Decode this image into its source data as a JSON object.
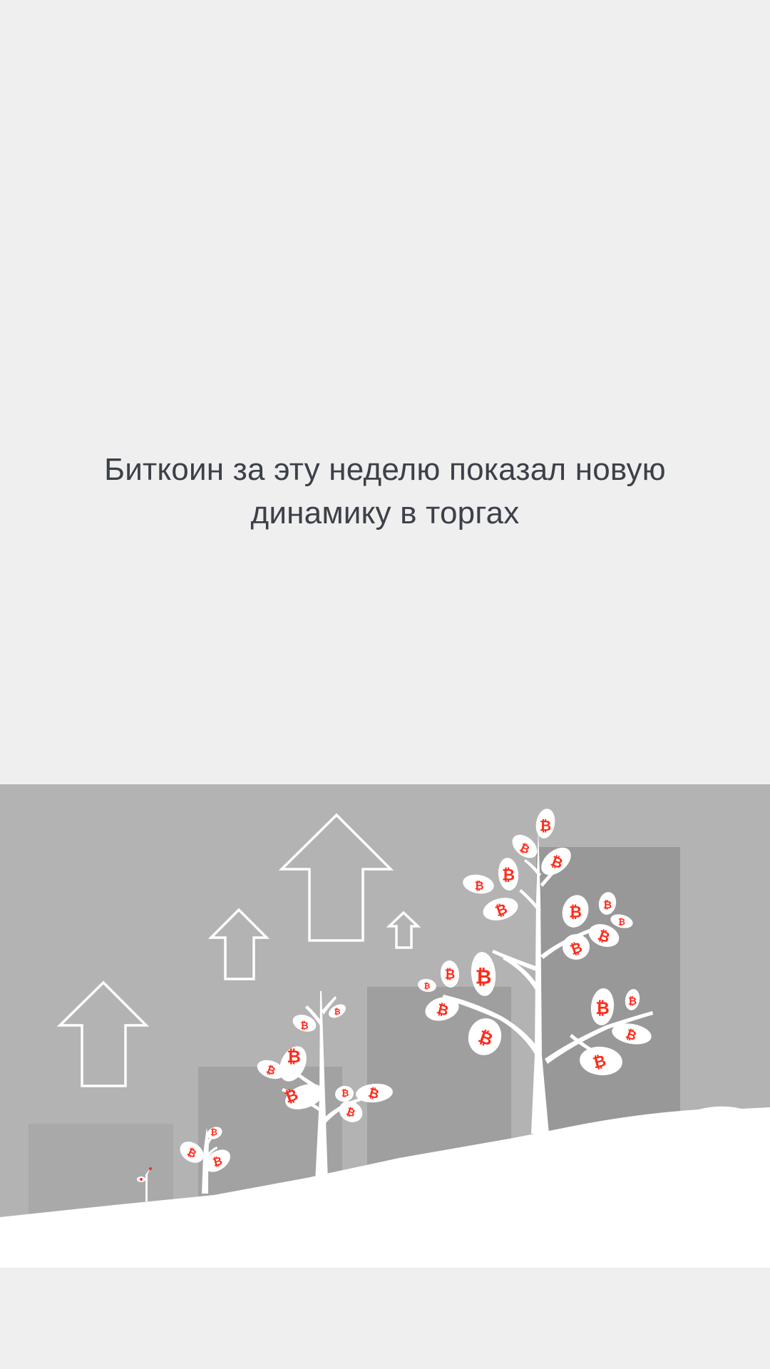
{
  "story": {
    "headline_line1": "Биткоин за эту неделю показал новую",
    "headline_line2": "динамику в торгах"
  },
  "illustration": {
    "subject": "bitcoin-money-trees",
    "leaf_symbol": "₿",
    "colors": {
      "page_background": "#efefef",
      "panel_background": "#b3b3b3",
      "bar_color": "#9c9c9c",
      "ground": "#ffffff",
      "tree": "#ffffff",
      "coin_red": "#ff2a1a",
      "text": "#3c4048"
    },
    "icons": [
      "up-arrow-icon",
      "tree-icon",
      "bitcoin-icon"
    ]
  }
}
